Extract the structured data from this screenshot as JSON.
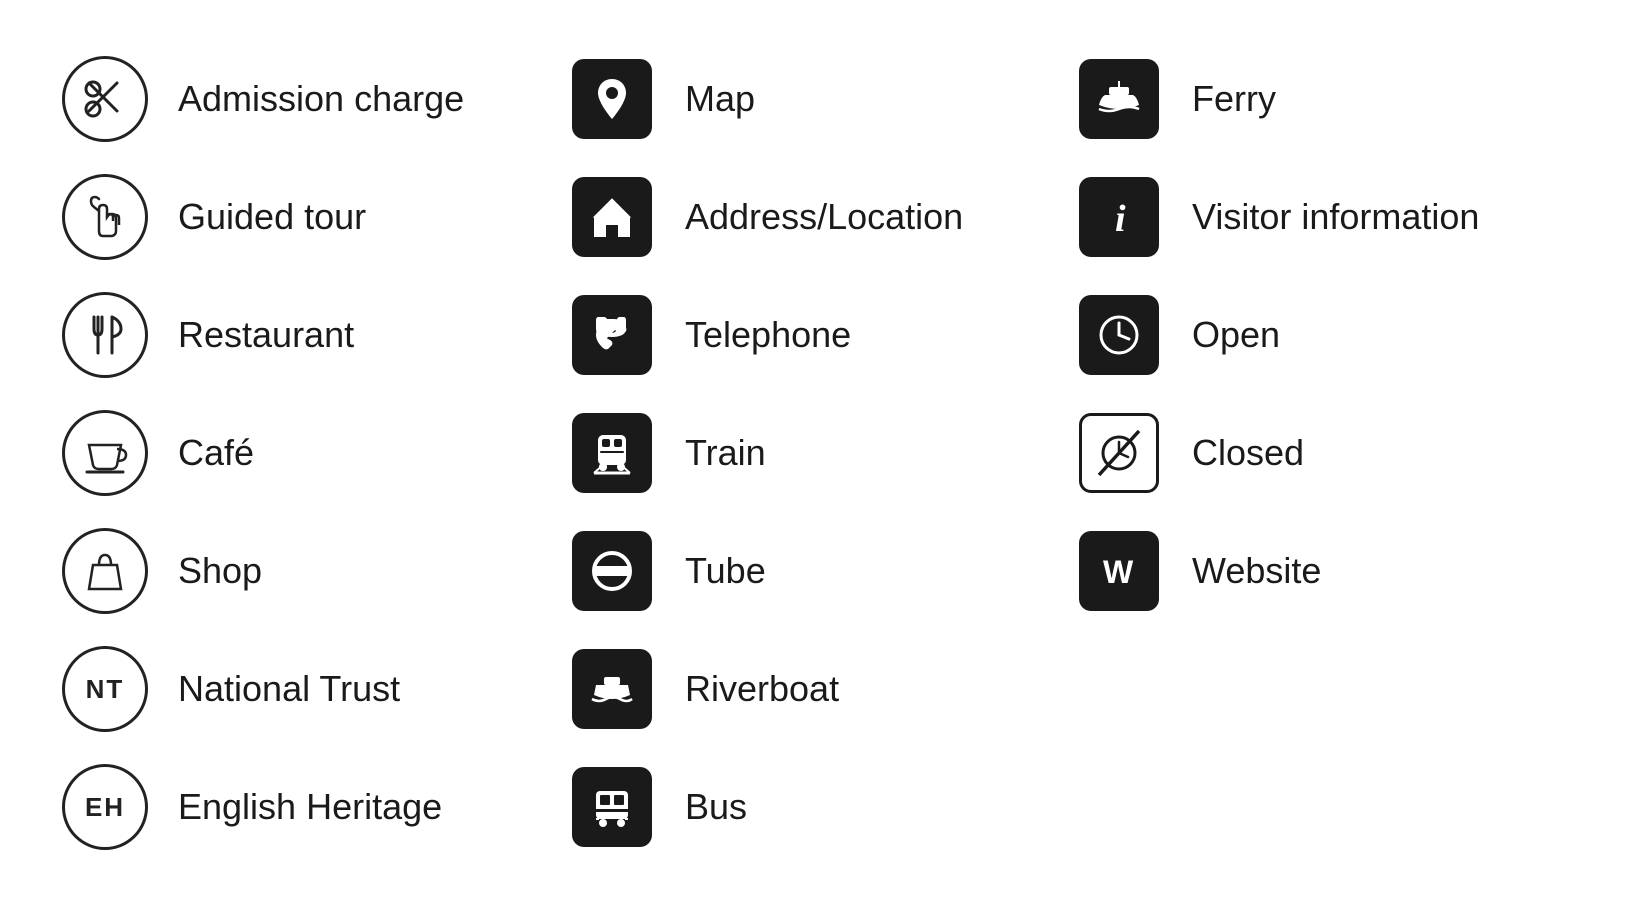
{
  "items": {
    "col1": [
      {
        "id": "admission-charge",
        "label": "Admission charge",
        "icon_type": "circle",
        "icon": "ticket"
      },
      {
        "id": "guided-tour",
        "label": "Guided tour",
        "icon_type": "circle",
        "icon": "hand"
      },
      {
        "id": "restaurant",
        "label": "Restaurant",
        "icon_type": "circle",
        "icon": "fork"
      },
      {
        "id": "cafe",
        "label": "Café",
        "icon_type": "circle",
        "icon": "cup"
      },
      {
        "id": "shop",
        "label": "Shop",
        "icon_type": "circle",
        "icon": "bag"
      },
      {
        "id": "national-trust",
        "label": "National Trust",
        "icon_type": "nt",
        "icon": "NT"
      },
      {
        "id": "english-heritage",
        "label": "English Heritage",
        "icon_type": "eh",
        "icon": "EH"
      }
    ],
    "col2": [
      {
        "id": "map",
        "label": "Map",
        "icon_type": "square",
        "icon": "map"
      },
      {
        "id": "address",
        "label": "Address/Location",
        "icon_type": "square",
        "icon": "house"
      },
      {
        "id": "telephone",
        "label": "Telephone",
        "icon_type": "square",
        "icon": "phone"
      },
      {
        "id": "train",
        "label": "Train",
        "icon_type": "square",
        "icon": "train"
      },
      {
        "id": "tube",
        "label": "Tube",
        "icon_type": "square",
        "icon": "tube"
      },
      {
        "id": "riverboat",
        "label": "Riverboat",
        "icon_type": "square",
        "icon": "riverboat"
      },
      {
        "id": "bus",
        "label": "Bus",
        "icon_type": "square",
        "icon": "bus"
      }
    ],
    "col3": [
      {
        "id": "ferry",
        "label": "Ferry",
        "icon_type": "square",
        "icon": "ferry"
      },
      {
        "id": "visitor-info",
        "label": "Visitor information",
        "icon_type": "square",
        "icon": "info"
      },
      {
        "id": "open",
        "label": "Open",
        "icon_type": "square",
        "icon": "clock"
      },
      {
        "id": "closed",
        "label": "Closed",
        "icon_type": "closed",
        "icon": "clock-closed"
      },
      {
        "id": "website",
        "label": "Website",
        "icon_type": "square",
        "icon": "W"
      }
    ]
  }
}
